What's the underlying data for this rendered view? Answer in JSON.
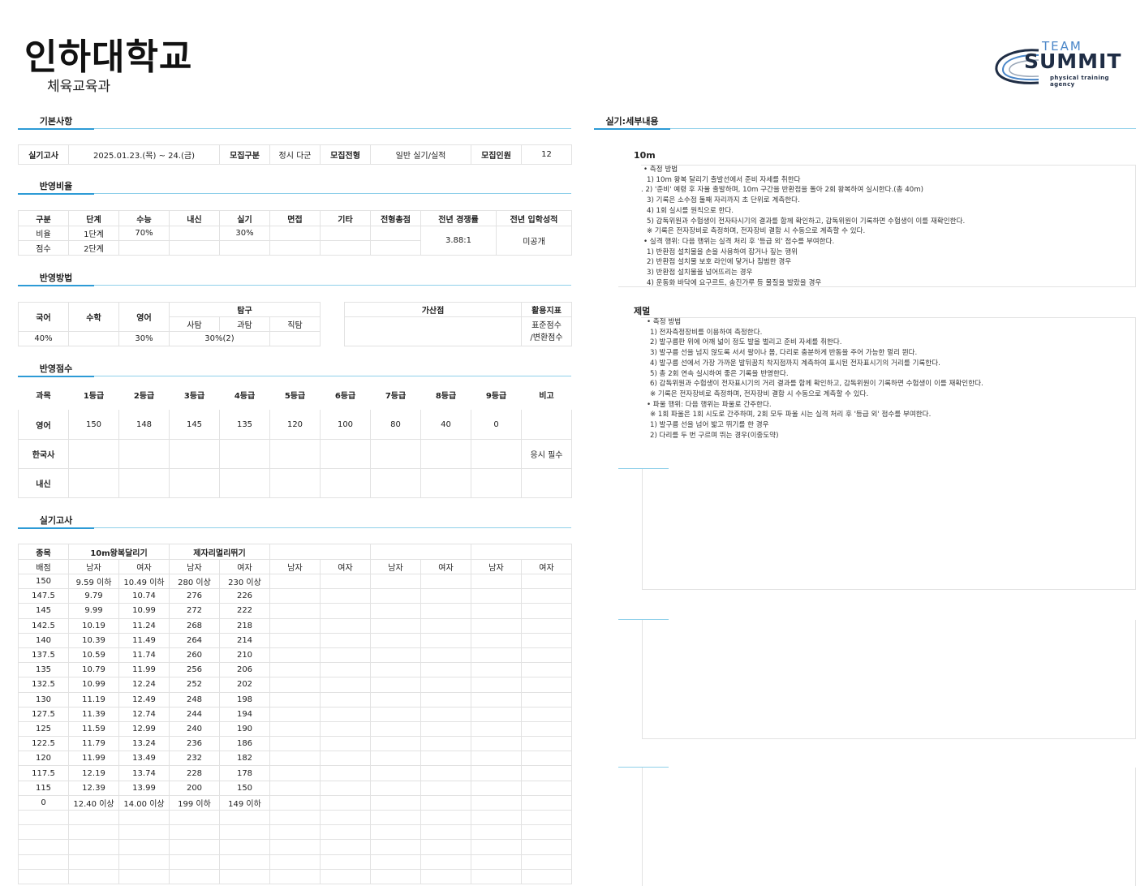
{
  "header": {
    "university": "인하대학교",
    "department": "체육교육과"
  },
  "logo": {
    "team": "TEAM",
    "summit": "SUMMIT",
    "agency": "physical training agency"
  },
  "sections": {
    "basic": "기본사항",
    "ratio": "반영비율",
    "method": "반영방법",
    "score": "반영점수",
    "practical": "실기고사",
    "detail": "실기:세부내용"
  },
  "basic": {
    "exam_label": "실기고사",
    "exam_date": "2025.01.23.(목) ~ 24.(금)",
    "recruit_type_label": "모집구분",
    "recruit_type": "정시 다군",
    "selection_label": "모집전형",
    "selection": "일반 실기/실적",
    "quota_label": "모집인원",
    "quota": "12"
  },
  "ratio": {
    "headers": [
      "구분",
      "단계",
      "수능",
      "내신",
      "실기",
      "면접",
      "기타",
      "전형총점",
      "전년 경쟁률",
      "전년 입학성적"
    ],
    "rows": [
      [
        "비율",
        "1단계",
        "70%",
        "",
        "30%",
        "",
        "",
        ""
      ],
      [
        "점수",
        "2단계",
        "",
        "",
        "",
        "",
        "",
        ""
      ]
    ],
    "competition": "3.88:1",
    "admission_score": "미공개"
  },
  "method": {
    "korean": "국어",
    "math": "수학",
    "english": "영어",
    "inquiry": "탐구",
    "inquiry_sub": [
      "사탐",
      "과탐",
      "직탐"
    ],
    "values": {
      "korean": "40%",
      "math": "",
      "english": "30%",
      "inquiry": "30%(2)"
    },
    "bonus_label": "가산점",
    "index_label": "활용지표",
    "index_values": [
      "표준점수",
      "/변환점수"
    ]
  },
  "score": {
    "headers": [
      "과목",
      "1등급",
      "2등급",
      "3등급",
      "4등급",
      "5등급",
      "6등급",
      "7등급",
      "8등급",
      "9등급",
      "비고"
    ],
    "rows": [
      [
        "영어",
        "150",
        "148",
        "145",
        "135",
        "120",
        "100",
        "80",
        "40",
        "0",
        ""
      ],
      [
        "한국사",
        "",
        "",
        "",
        "",
        "",
        "",
        "",
        "",
        "",
        "응시 필수"
      ],
      [
        "내신",
        "",
        "",
        "",
        "",
        "",
        "",
        "",
        "",
        "",
        ""
      ]
    ]
  },
  "practical": {
    "event_label": "종목",
    "events": [
      "10m왕복달리기",
      "제자리멀리뛰기"
    ],
    "score_label": "배점",
    "gender": [
      "남자",
      "여자",
      "남자",
      "여자",
      "남자",
      "여자",
      "남자",
      "여자",
      "남자",
      "여자"
    ],
    "rows": [
      [
        "150",
        "9.59 이하",
        "10.49 이하",
        "280 이상",
        "230 이상"
      ],
      [
        "147.5",
        "9.79",
        "10.74",
        "276",
        "226"
      ],
      [
        "145",
        "9.99",
        "10.99",
        "272",
        "222"
      ],
      [
        "142.5",
        "10.19",
        "11.24",
        "268",
        "218"
      ],
      [
        "140",
        "10.39",
        "11.49",
        "264",
        "214"
      ],
      [
        "137.5",
        "10.59",
        "11.74",
        "260",
        "210"
      ],
      [
        "135",
        "10.79",
        "11.99",
        "256",
        "206"
      ],
      [
        "132.5",
        "10.99",
        "12.24",
        "252",
        "202"
      ],
      [
        "130",
        "11.19",
        "12.49",
        "248",
        "198"
      ],
      [
        "127.5",
        "11.39",
        "12.74",
        "244",
        "194"
      ],
      [
        "125",
        "11.59",
        "12.99",
        "240",
        "190"
      ],
      [
        "122.5",
        "11.79",
        "13.24",
        "236",
        "186"
      ],
      [
        "120",
        "11.99",
        "13.49",
        "232",
        "182"
      ],
      [
        "117.5",
        "12.19",
        "13.74",
        "228",
        "178"
      ],
      [
        "115",
        "12.39",
        "13.99",
        "200",
        "150"
      ],
      [
        "0",
        "12.40 이상",
        "14.00 이상",
        "199 이하",
        "149 이하"
      ]
    ]
  },
  "detail": {
    "event1_title": "10m",
    "event1_notes": [
      "• 측정 방법",
      "1) 10m 왕복 달리기 출발선에서 준비 자세를 취한다",
      ". 2) '준비' 예령 후 자율 출발하며, 10m 구간을 반환점을 돌아 2회 왕복하여 실시한다.(총 40m)",
      "3) 기록은 소수점 둘째 자리까지 초 단위로 계측한다.",
      "4) 1회 실시를 원칙으로 한다.",
      "5) 감독위원과 수험생이 전자타시기의 결과를 함께 확인하고, 감독위원이 기록하면 수험생이 이를 재확인한다.",
      "※ 기록은 전자장비로 측정하며, 전자장비 결함 시 수동으로 계측할 수 있다.",
      "• 실격 행위: 다음 행위는 실격 처리 후 '등급 외' 점수를 부여한다.",
      "1) 반환점 설치물을 손을 사용하여 잡거나 짚는 행위",
      "2) 반환점 설치물 보호 라인에 닿거나 침범한 경우",
      "3) 반환점 설치물을 넘어뜨리는 경우",
      "4) 운동화 바닥에 요구르트, 송진가루 등 물질을 발랐을 경우"
    ],
    "event2_title": "제멀",
    "event2_notes": [
      "• 측정 방법",
      "1) 전자측정장비를 이용하여 측정한다.",
      "2) 발구름판 위에 어깨 넓이 정도 발을 벌리고 준비 자세를 취한다.",
      "3) 발구름 선을 넘지 않도록 서서 팔이나 몸, 다리로 충분하게 반동을 주어 가능한 멀리 뛴다.",
      "4) 발구름 선에서 가장 가까운 발뒤꿈치 착지점까지 계측하여 표시된 전자표시기의 거리를 기록한다.",
      "5) 총 2회 연속 실시하여 좋은 기록을 반영한다.",
      "6) 감독위원과 수험생이 전자표시기의 거리 결과를 함께 확인하고, 감독위원이 기록하면 수험생이 이를 재확인한다.",
      "※ 기록은 전자장비로 측정하며, 전자장비 결함 시 수동으로 계측할 수 있다.",
      "• 파울 행위: 다음 행위는 파울로 간주한다.",
      "※ 1회 파울은 1회 시도로 간주하며, 2회 모두 파울 시는 실격 처리 후 '등급 외' 점수를 부여한다.",
      "1) 발구름 선을 넘어 밟고 뛰기를 한 경우",
      "2) 다리를 두 번 구르며 뛰는 경우(이중도약)"
    ]
  }
}
